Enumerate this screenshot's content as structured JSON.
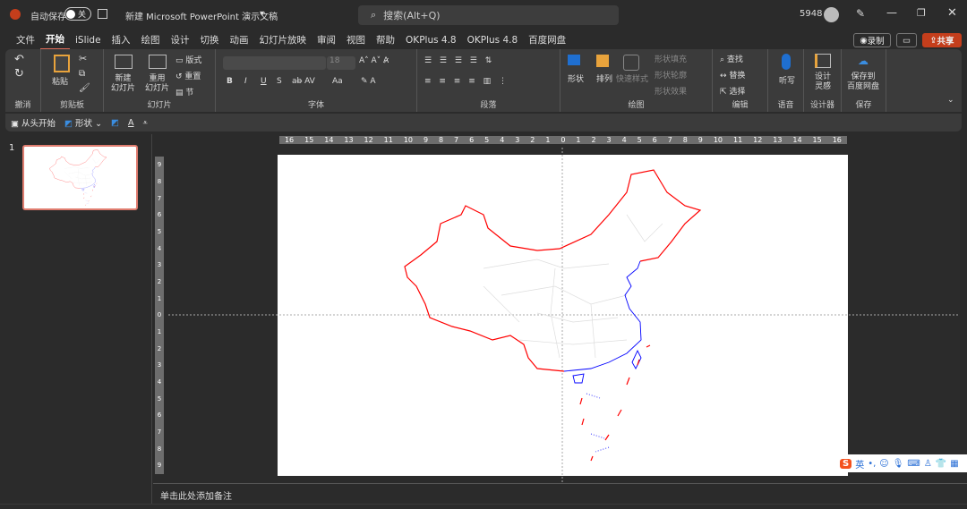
{
  "titlebar": {
    "autosave_label": "自动保存",
    "autosave_state": "关",
    "doc_title": "新建 Microsoft PowerPoint 演示文稿",
    "search_placeholder": "搜索(Alt+Q)",
    "user": "5948"
  },
  "tabs": [
    "文件",
    "开始",
    "iSlide",
    "插入",
    "绘图",
    "设计",
    "切换",
    "动画",
    "幻灯片放映",
    "审阅",
    "视图",
    "帮助",
    "OKPlus 4.8",
    "OKPlus 4.8",
    "百度网盘"
  ],
  "actions": {
    "record": "录制",
    "share": "共享"
  },
  "ribbon": {
    "undo": {
      "label": "撤消"
    },
    "clipboard": {
      "paste": "粘贴",
      "label": "剪贴板"
    },
    "slides": {
      "new": "新建",
      "new2": "幻灯片",
      "reuse": "重用",
      "reuse2": "幻灯片",
      "layout": "版式",
      "reset": "重置",
      "section": "节",
      "label": "幻灯片"
    },
    "font": {
      "size": "18",
      "label": "字体",
      "b": "B",
      "i": "I",
      "u": "U",
      "s": "S",
      "aa": "Aa"
    },
    "paragraph": {
      "label": "段落"
    },
    "drawing": {
      "shapes": "形状",
      "arrange": "排列",
      "quick": "快速样式",
      "fill": "形状填充",
      "outline": "形状轮廓",
      "effects": "形状效果",
      "label": "绘图"
    },
    "editing": {
      "find": "查找",
      "replace": "替换",
      "select": "选择",
      "label": "编辑"
    },
    "voice": {
      "dictate": "听写",
      "label": "语音"
    },
    "designer": {
      "ideas": "设计",
      "ideas2": "灵感",
      "label": "设计器"
    },
    "save": {
      "to": "保存到",
      "to2": "百度网盘",
      "label": "保存"
    }
  },
  "qat": {
    "from_start": "从头开始",
    "shapes": "形状"
  },
  "slide_number": "1",
  "hruler": [
    "16",
    "15",
    "14",
    "13",
    "12",
    "11",
    "10",
    "9",
    "8",
    "7",
    "6",
    "5",
    "4",
    "3",
    "2",
    "1",
    "0",
    "1",
    "2",
    "3",
    "4",
    "5",
    "6",
    "7",
    "8",
    "9",
    "10",
    "11",
    "12",
    "13",
    "14",
    "15",
    "16"
  ],
  "vruler": [
    "9",
    "8",
    "7",
    "6",
    "5",
    "4",
    "3",
    "2",
    "1",
    "0",
    "1",
    "2",
    "3",
    "4",
    "5",
    "6",
    "7",
    "8",
    "9"
  ],
  "notes_placeholder": "单击此处添加备注",
  "ime": {
    "lang": "英"
  },
  "colors": {
    "border": "#ff0000",
    "coast": "#0000ff",
    "share": "#c43e1c"
  }
}
